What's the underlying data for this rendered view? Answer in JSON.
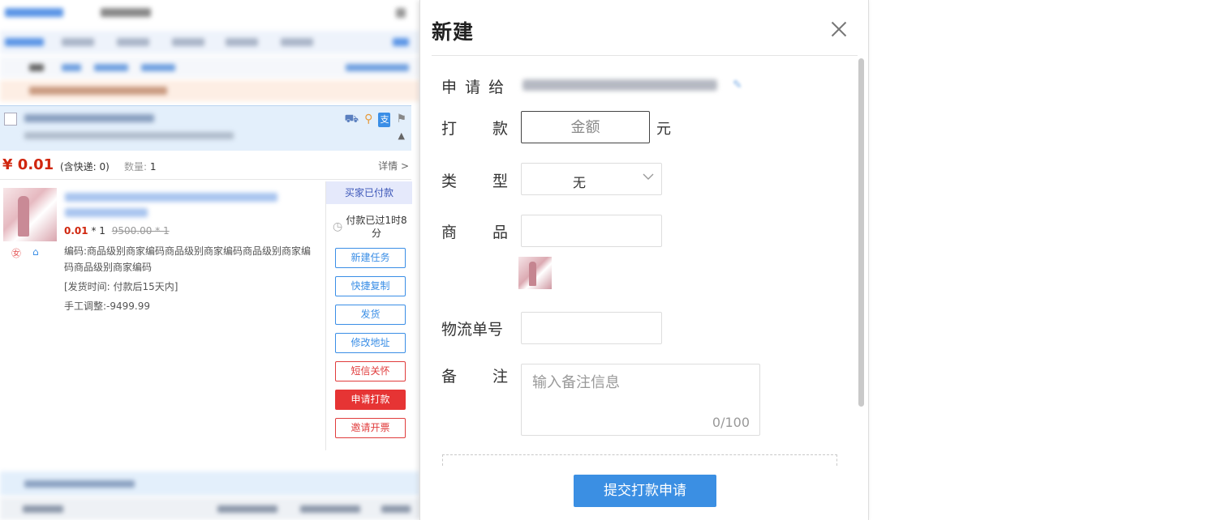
{
  "order": {
    "price": "¥ 0.01",
    "incl_shipping": "(含快递: 0)",
    "qty_label": "数量:",
    "qty_value": "1",
    "details_link": "详情 >",
    "unit_price": "0.01",
    "times_qty": "* 1",
    "original_price": "9500.00 * 1",
    "sku_code": "编码:商品级别商家编码商品级别商家编码商品级别商家编码商品级别商家编码",
    "ship_time": "[发货时间: 付款后15天内]",
    "manual_adjust": "手工调整:-9499.99",
    "status_badge": "买家已付款",
    "timer_text": "付款已过1时8分",
    "actions": {
      "new_task": "新建任务",
      "quick_copy": "快捷复制",
      "ship": "发货",
      "edit_address": "修改地址",
      "sms_care": "短信关怀",
      "apply_payment": "申请打款",
      "invite_invoice": "邀请开票"
    }
  },
  "modal": {
    "title": "新建",
    "labels": {
      "apply_to": "申 请 给",
      "amount": "打 款",
      "type": "类 型",
      "goods": "商 品",
      "tracking": "物流单号",
      "remark": "备 注"
    },
    "amount_placeholder": "金额",
    "amount_unit": "元",
    "type_value": "无",
    "remark_placeholder": "输入备注信息",
    "remark_counter": "0/100",
    "submit_label": "提交打款申请"
  },
  "colors": {
    "accent_blue": "#3b8fe3",
    "price_red": "#d0260e",
    "danger_red": "#e63434"
  }
}
